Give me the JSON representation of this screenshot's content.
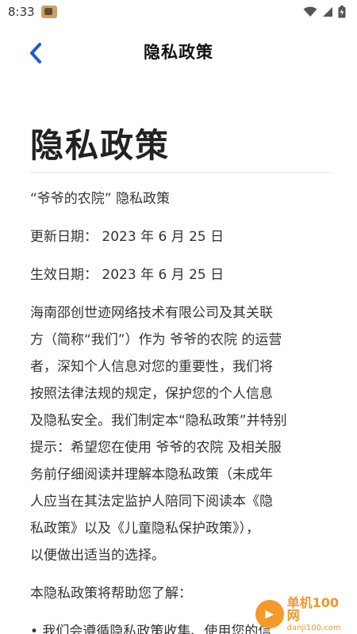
{
  "status_bar": {
    "time": "8:33",
    "icons": [
      "app-notification-icon",
      "wifi-icon",
      "signal-icon",
      "battery-icon"
    ]
  },
  "header": {
    "back_icon": "chevron-left-icon",
    "title": "隐私政策"
  },
  "document": {
    "title": "隐私政策",
    "subtitle": "“爷爷的农院” 隐私政策",
    "updated": "更新日期： 2023 年 6 月 25 日",
    "effective": "生效日期： 2023 年 6 月 25 日",
    "intro_lines": [
      "海南邵创世迹网络技术有限公司及其关联",
      "方（简称“我们”）作为 爷爷的农院 的运营",
      "者，深知个人信息对您的重要性，我们将",
      "按照法律法规的规定，保护您的个人信息",
      "及隐私安全。我们制定本“隐私政策”并特别",
      "提示：希望您在使用 爷爷的农院 及相关服",
      "务前仔细阅读并理解本隐私政策（未成年",
      "人应当在其法定监护人陪同下阅读本《隐",
      "私政策》以及《儿童隐私保护政策》），",
      "以便做出适当的选择。"
    ],
    "help_heading": "本隐私政策将帮助您了解：",
    "bullet_1": "• 我们会遵循隐私政策收集、使用您的信"
  },
  "watermark": {
    "text_cn": "单机100网",
    "text_en": "danji100.com"
  },
  "colors": {
    "accent": "#1f5bd6",
    "text": "#333333",
    "watermark": "#f0962a"
  }
}
